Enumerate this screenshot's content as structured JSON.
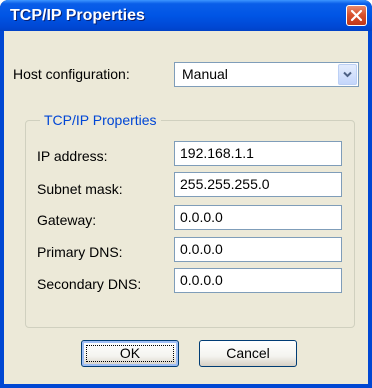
{
  "window": {
    "title": "TCP/IP Properties"
  },
  "host_config": {
    "label": "Host configuration:",
    "value": "Manual"
  },
  "group": {
    "title": "TCP/IP Properties"
  },
  "fields": [
    {
      "label": "IP address:",
      "value": "192.168.1.1"
    },
    {
      "label": "Subnet mask:",
      "value": "255.255.255.0"
    },
    {
      "label": "Gateway:",
      "value": "0.0.0.0"
    },
    {
      "label": "Primary DNS:",
      "value": "0.0.0.0"
    },
    {
      "label": "Secondary DNS:",
      "value": "0.0.0.0"
    }
  ],
  "buttons": {
    "ok": "OK",
    "cancel": "Cancel"
  },
  "colors": {
    "titlebar": "#0055e5",
    "close_button": "#d9522d",
    "dialog_background": "#ece9d8",
    "group_title": "#0046d5"
  },
  "icons": {
    "close": "close-icon",
    "dropdown": "chevron-down-icon"
  }
}
